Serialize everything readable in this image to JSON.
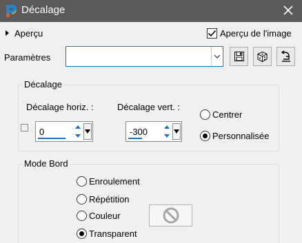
{
  "window": {
    "title": "Décalage",
    "app_icon": "paintshop-pro-logo",
    "close_icon": "close-icon"
  },
  "preview": {
    "toggle_label": "Aperçu",
    "checkbox_label": "Aperçu de l'image",
    "checkbox_checked": true
  },
  "params": {
    "label": "Paramètres",
    "preset_value": "",
    "buttons": [
      {
        "name": "save-preset-button",
        "icon": "save-icon"
      },
      {
        "name": "randomize-button",
        "icon": "dice-icon"
      },
      {
        "name": "reset-button",
        "icon": "reset-icon"
      }
    ]
  },
  "offset": {
    "title": "Décalage",
    "horiz_label": "Décalage horiz. :",
    "horiz_value": "0",
    "vert_label": "Décalage vert. :",
    "vert_value": "-300",
    "link_checked": false,
    "options": [
      {
        "label": "Centrer",
        "selected": false
      },
      {
        "label": "Personnalisée",
        "selected": true
      }
    ]
  },
  "edge_mode": {
    "title": "Mode Bord",
    "options": [
      {
        "label": "Enroulement",
        "selected": false
      },
      {
        "label": "Répétition",
        "selected": false
      },
      {
        "label": "Couleur",
        "selected": false
      },
      {
        "label": "Transparent",
        "selected": true
      }
    ],
    "color_swatch_icon": "no-color-icon"
  },
  "colors": {
    "titlebar": "#5a5a5a",
    "accent": "#0078d7",
    "background": "#f0f0f0"
  }
}
